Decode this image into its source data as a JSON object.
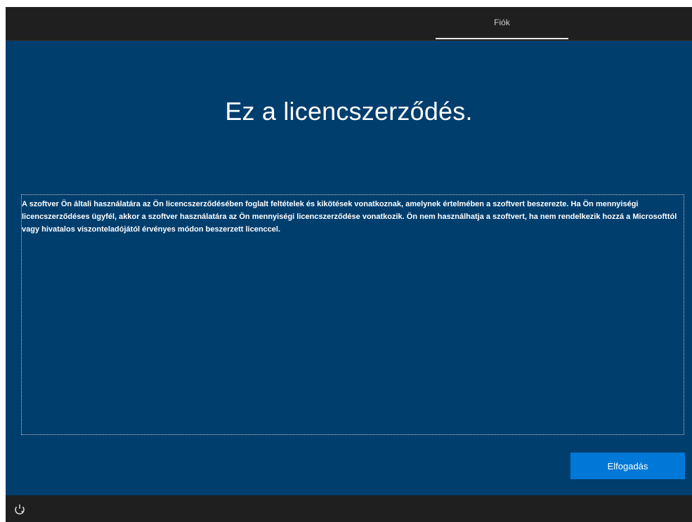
{
  "header": {
    "tab_label": "Fiók"
  },
  "main": {
    "title": "Ez a licencszerződés.",
    "license_text": "A szoftver Ön általi használatára az Ön licencszerződésében foglalt feltételek és kikötések vonatkoznak, amelynek értelmében a szoftvert beszerezte. Ha Ön mennyiségi licencszerződéses ügyfél, akkor a szoftver használatára az Ön mennyiségi licencszerződése vonatkozik. Ön nem használhatja a szoftvert, ha nem rendelkezik hozzá a Microsofttól vagy hivatalos viszonteladójától érvényes módon beszerzett licenccel."
  },
  "footer": {
    "accept_label": "Elfogadás",
    "accessibility_icon": "ease-of-access-icon"
  },
  "colors": {
    "background": "#003e6e",
    "bar": "#1f1f1f",
    "accent": "#0078d7"
  }
}
